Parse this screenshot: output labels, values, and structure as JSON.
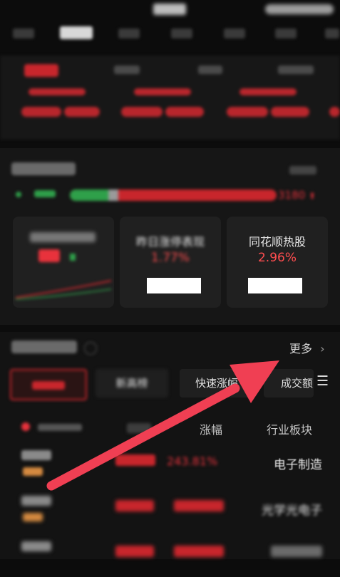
{
  "status_bar": {
    "time": "",
    "battery": ""
  },
  "market_tabs": [
    "",
    "",
    "",
    "",
    "",
    "",
    ""
  ],
  "index_tabs": [
    "",
    "",
    "",
    ""
  ],
  "heat": {
    "title": "",
    "more": "",
    "rise_count": "",
    "fall_count": "3180",
    "cards": [
      {
        "title": "",
        "value": ""
      },
      {
        "title": "昨日涨停表现",
        "value": "1.77%"
      },
      {
        "title": "同花顺热股",
        "value": "2.96%"
      }
    ]
  },
  "hot": {
    "title": "",
    "more": "更多",
    "filters": [
      "",
      "新高榜",
      "快速涨幅",
      "成交额"
    ],
    "menu_icon": "menu-icon",
    "columns": {
      "name": "",
      "price": "",
      "change": "涨幅",
      "sector": "行业板块"
    },
    "rows": [
      {
        "name": "",
        "price": "",
        "change": "243.81%",
        "sector": "电子制造"
      },
      {
        "name": "",
        "price": "",
        "change": "",
        "sector": "光学光电子"
      },
      {
        "name": "",
        "price": "",
        "change": "",
        "sector": ""
      }
    ]
  },
  "colors": {
    "accent_red": "#e8323c",
    "rise_green": "#2fa04a",
    "annotation_arrow": "#f03f53"
  }
}
